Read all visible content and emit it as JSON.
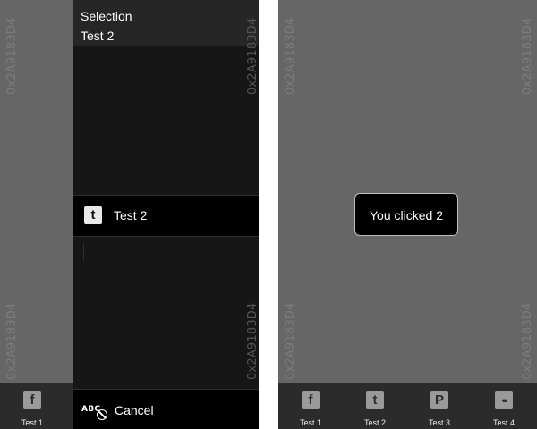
{
  "watermark": "0x2A9183D4",
  "left_phone": {
    "selection_sheet": {
      "title": "Selection",
      "selected_value": "Test 2",
      "items": [
        {
          "label": "Test 2",
          "icon": "tumblr-icon"
        }
      ],
      "cancel_label": "Cancel",
      "cancel_icon": "abc-cancel-icon"
    },
    "tabs": [
      {
        "label": "Test 1",
        "icon": "facebook-icon",
        "glyph": "f"
      }
    ]
  },
  "right_phone": {
    "toast": "You clicked 2",
    "tabs": [
      {
        "label": "Test 1",
        "icon": "facebook-icon",
        "glyph": "f"
      },
      {
        "label": "Test 2",
        "icon": "tumblr-icon",
        "glyph": "t"
      },
      {
        "label": "Test 3",
        "icon": "pinterest-icon",
        "glyph": "P"
      },
      {
        "label": "Test 4",
        "icon": "flickr-icon",
        "glyph": "••"
      }
    ]
  }
}
